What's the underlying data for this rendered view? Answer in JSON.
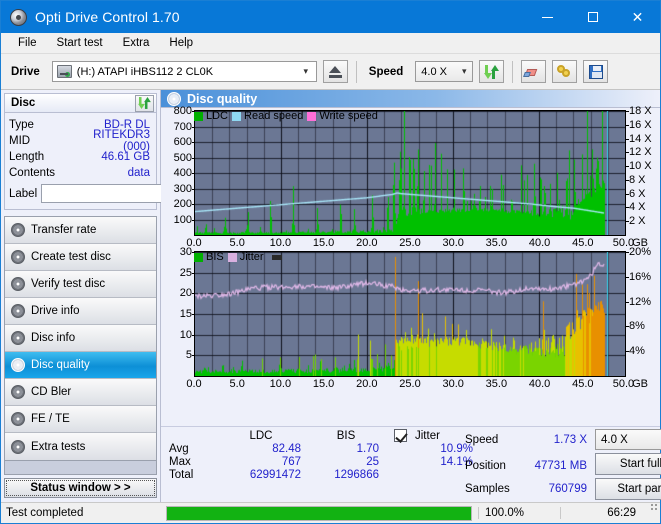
{
  "window": {
    "title": "Opti Drive Control 1.70",
    "icon": "disc-icon",
    "minimize": "–",
    "maximize": "□",
    "close": "✕"
  },
  "menu": [
    {
      "label": "File"
    },
    {
      "label": "Start test"
    },
    {
      "label": "Extra"
    },
    {
      "label": "Help"
    }
  ],
  "toolbar": {
    "drive_label": "Drive",
    "drive_value": "(H:)  ATAPI iHBS112  2 CL0K",
    "eject_icon": "eject-icon",
    "speed_label": "Speed",
    "speed_value": "4.0 X",
    "refresh_icon": "refresh-icon",
    "eraser_icon": "eraser-icon",
    "keys_icon": "keys-icon",
    "save_icon": "save-icon"
  },
  "disc_panel": {
    "title": "Disc",
    "refresh_icon": "refresh-icon",
    "rows": [
      {
        "key": "Type",
        "value": "BD-R DL"
      },
      {
        "key": "MID",
        "value": "RITEKDR3 (000)"
      },
      {
        "key": "Length",
        "value": "46.61 GB"
      },
      {
        "key": "Contents",
        "value": "data"
      }
    ],
    "label_key": "Label",
    "label_value": "",
    "label_placeholder": "",
    "label_button_icon": "cd-icon"
  },
  "nav": {
    "items": [
      {
        "label": "Transfer rate",
        "icon": "disc-icon",
        "active": false
      },
      {
        "label": "Create test disc",
        "icon": "disc-icon",
        "active": false
      },
      {
        "label": "Verify test disc",
        "icon": "disc-icon",
        "active": false
      },
      {
        "label": "Drive info",
        "icon": "disc-icon",
        "active": false
      },
      {
        "label": "Disc info",
        "icon": "disc-icon",
        "active": false
      },
      {
        "label": "Disc quality",
        "icon": "disc-icon",
        "active": true
      },
      {
        "label": "CD Bler",
        "icon": "disc-icon",
        "active": false
      },
      {
        "label": "FE / TE",
        "icon": "disc-icon",
        "active": false
      },
      {
        "label": "Extra tests",
        "icon": "disc-icon",
        "active": false
      }
    ],
    "status_button": "Status window > >"
  },
  "content": {
    "title": "Disc quality",
    "icon": "disc-icon"
  },
  "stats": {
    "col_headers": [
      "LDC",
      "BIS"
    ],
    "jitter_label": "Jitter",
    "jitter_checked": true,
    "rows": [
      {
        "key": "Avg",
        "ldc": "82.48",
        "bis": "1.70",
        "jitter": "10.9%"
      },
      {
        "key": "Max",
        "ldc": "767",
        "bis": "25",
        "jitter": "14.1%"
      },
      {
        "key": "Total",
        "ldc": "62991472",
        "bis": "1296866",
        "jitter": ""
      }
    ]
  },
  "readout": {
    "speed_key": "Speed",
    "speed_value": "1.73 X",
    "position_key": "Position",
    "position_value": "47731 MB",
    "samples_key": "Samples",
    "samples_value": "760799",
    "speed_select": "4.0 X",
    "start_full": "Start full",
    "start_part": "Start part"
  },
  "statusbar": {
    "message": "Test completed",
    "progress_percent": 100,
    "progress_label": "100.0%",
    "elapsed": "66:29"
  },
  "chart_data": [
    {
      "id": "ldc-chart",
      "type": "area",
      "title": "",
      "xlabel": "GB",
      "ylabel": "",
      "xlim": [
        0,
        50
      ],
      "ylim": [
        0,
        800
      ],
      "y2lim": [
        0,
        18
      ],
      "y2label": "X",
      "grid": true,
      "plot_bg": "#6b7794",
      "xticks": [
        "0.0",
        "5.0",
        "10.0",
        "15.0",
        "20.0",
        "25.0",
        "30.0",
        "35.0",
        "40.0",
        "45.0",
        "50.0"
      ],
      "xtick_values": [
        0,
        5,
        10,
        15,
        20,
        25,
        30,
        35,
        40,
        45,
        50
      ],
      "yticks": [
        100,
        200,
        300,
        400,
        500,
        600,
        700,
        800
      ],
      "y2ticks": [
        "2 X",
        "4 X",
        "6 X",
        "8 X",
        "10 X",
        "12 X",
        "14 X",
        "16 X",
        "18 X"
      ],
      "y2tick_values": [
        2,
        4,
        6,
        8,
        10,
        12,
        14,
        16,
        18
      ],
      "legend": [
        {
          "label": "LDC",
          "color": "#00b000"
        },
        {
          "label": "Read speed",
          "color": "#8fd8f2"
        },
        {
          "label": "Write speed",
          "color": "#ff6fd8"
        }
      ],
      "legend_position": "top-left",
      "series": [
        {
          "name": "LDC",
          "color": "#00c000",
          "kind": "impulse",
          "baseline_x": [
            0,
            2,
            4,
            6,
            8,
            10,
            12,
            14,
            16,
            18,
            20,
            22,
            23,
            24,
            25,
            26,
            28,
            30,
            32,
            34,
            36,
            38,
            40,
            42,
            44,
            46,
            47,
            48,
            49,
            50
          ],
          "baseline_y": [
            15,
            12,
            12,
            14,
            13,
            14,
            15,
            16,
            18,
            20,
            22,
            25,
            30,
            110,
            130,
            120,
            115,
            110,
            108,
            105,
            100,
            105,
            110,
            120,
            140,
            170,
            210,
            60,
            40,
            30
          ],
          "spike_x": [
            1.2,
            3.5,
            6.1,
            8.8,
            11.4,
            14.2,
            16.9,
            18.5,
            20.6,
            22.4,
            23.1,
            23.8,
            24.3,
            24.9,
            25.4,
            25.9,
            26.6,
            27.2,
            27.9,
            28.6,
            29.3,
            30.1,
            31.2,
            32.4,
            33.1,
            34.5,
            35.6,
            36.8,
            37.9,
            38.6,
            39.4,
            40.2,
            41.3,
            42.1,
            43.2,
            44.1,
            45.0,
            45.6,
            46.2,
            46.8,
            47.3
          ],
          "spike_y": [
            60,
            120,
            95,
            150,
            210,
            190,
            260,
            180,
            290,
            330,
            620,
            700,
            640,
            560,
            720,
            680,
            500,
            480,
            620,
            540,
            430,
            470,
            560,
            360,
            420,
            380,
            440,
            350,
            470,
            400,
            520,
            450,
            380,
            420,
            560,
            600,
            520,
            480,
            720,
            767,
            700
          ]
        },
        {
          "name": "Read speed",
          "color": "#a8e6f8",
          "kind": "line",
          "x": [
            0,
            2,
            5,
            8,
            11,
            14,
            17,
            20,
            23,
            23.5,
            24,
            27,
            30,
            33,
            36,
            39,
            42,
            44,
            45,
            46,
            47,
            47.5
          ],
          "y": [
            3.4,
            3.6,
            3.9,
            4.2,
            4.5,
            4.8,
            5.1,
            5.4,
            5.9,
            6.1,
            6.0,
            5.7,
            5.4,
            5.1,
            4.8,
            4.5,
            4.1,
            3.9,
            3.7,
            3.5,
            3.3,
            3.2
          ]
        }
      ]
    },
    {
      "id": "bis-chart",
      "type": "area",
      "title": "",
      "xlabel": "GB",
      "ylabel": "",
      "xlim": [
        0,
        50
      ],
      "ylim": [
        0,
        30
      ],
      "y2lim": [
        0,
        20
      ],
      "y2label": "%",
      "grid": true,
      "plot_bg": "#6b7794",
      "xticks": [
        "0.0",
        "5.0",
        "10.0",
        "15.0",
        "20.0",
        "25.0",
        "30.0",
        "35.0",
        "40.0",
        "45.0",
        "50.0"
      ],
      "xtick_values": [
        0,
        5,
        10,
        15,
        20,
        25,
        30,
        35,
        40,
        45,
        50
      ],
      "yticks": [
        5,
        10,
        15,
        20,
        25,
        30
      ],
      "y2ticks": [
        "4%",
        "8%",
        "12%",
        "16%",
        "20%"
      ],
      "y2tick_values": [
        4,
        8,
        12,
        16,
        20
      ],
      "legend": [
        {
          "label": "BIS",
          "color": "#00b000"
        },
        {
          "label": "Jitter",
          "color": "#d9b0e0"
        }
      ],
      "legend_position": "top-left",
      "series": [
        {
          "name": "BIS",
          "color": "#00c000",
          "color_mid": "#c8e000",
          "color_high": "#e09000",
          "kind": "impulse",
          "baseline_x": [
            0,
            2,
            4,
            6,
            8,
            10,
            12,
            14,
            16,
            18,
            20,
            22,
            23,
            23.6,
            24,
            26,
            28,
            30,
            32,
            34,
            36,
            38,
            40,
            42,
            44,
            45,
            46,
            47,
            48
          ],
          "baseline_y": [
            1.2,
            1.0,
            1.0,
            1.1,
            1.0,
            1.1,
            1.2,
            1.2,
            1.3,
            1.4,
            1.5,
            1.6,
            1.8,
            6.5,
            7.0,
            6.5,
            6.2,
            6.0,
            5.8,
            5.6,
            5.4,
            4.8,
            6.0,
            7.0,
            9.0,
            11.0,
            12.0,
            5.0,
            2.0
          ],
          "spike_x": [
            1.1,
            3.2,
            5.4,
            7.8,
            9.9,
            12.1,
            14.6,
            16.3,
            18.9,
            20.4,
            22.1,
            23.3,
            23.9,
            24.4,
            25.1,
            25.8,
            26.4,
            27.1,
            27.8,
            28.5,
            29.2,
            30.3,
            31.5,
            32.6,
            33.4,
            34.8,
            35.9,
            37.1,
            38.2,
            39.1,
            40.4,
            41.6,
            42.3,
            43.5,
            44.4,
            45.2,
            45.8,
            46.4,
            46.9
          ],
          "spike_y": [
            3,
            4,
            3.5,
            4.5,
            5,
            4.8,
            6,
            5.2,
            6.5,
            7,
            8,
            16,
            14,
            12,
            13,
            11,
            10,
            12,
            11,
            9,
            10,
            13,
            12,
            9,
            11,
            10,
            12,
            9,
            11,
            10,
            13,
            12,
            11,
            14,
            18,
            20,
            22,
            25,
            21
          ]
        },
        {
          "name": "Jitter",
          "color": "#e0b8e8",
          "kind": "line",
          "x": [
            0,
            1,
            2,
            3,
            4,
            5,
            6,
            7,
            8,
            9,
            10,
            11,
            12,
            13,
            14,
            15,
            16,
            17,
            18,
            19,
            20,
            21,
            22,
            23,
            24,
            25,
            26,
            27,
            28,
            29,
            30,
            31,
            32,
            33,
            34,
            35,
            36,
            37,
            38,
            39,
            40,
            41,
            42,
            43,
            44,
            45,
            46,
            46.5,
            47
          ],
          "y": [
            12.8,
            12.9,
            13.0,
            13.1,
            13.3,
            13.5,
            13.9,
            14.2,
            14.3,
            14.3,
            14.3,
            14.4,
            14.5,
            14.4,
            14.3,
            14.2,
            14.2,
            14.3,
            14.5,
            14.8,
            15.0,
            14.9,
            14.6,
            14.4,
            13.9,
            13.8,
            13.8,
            13.8,
            13.9,
            13.9,
            13.9,
            13.9,
            13.8,
            13.8,
            13.7,
            13.5,
            13.4,
            13.6,
            14.0,
            14.2,
            14.1,
            14.0,
            14.2,
            14.4,
            14.7,
            15.2,
            16.2,
            17.4,
            18.0
          ]
        }
      ]
    }
  ]
}
